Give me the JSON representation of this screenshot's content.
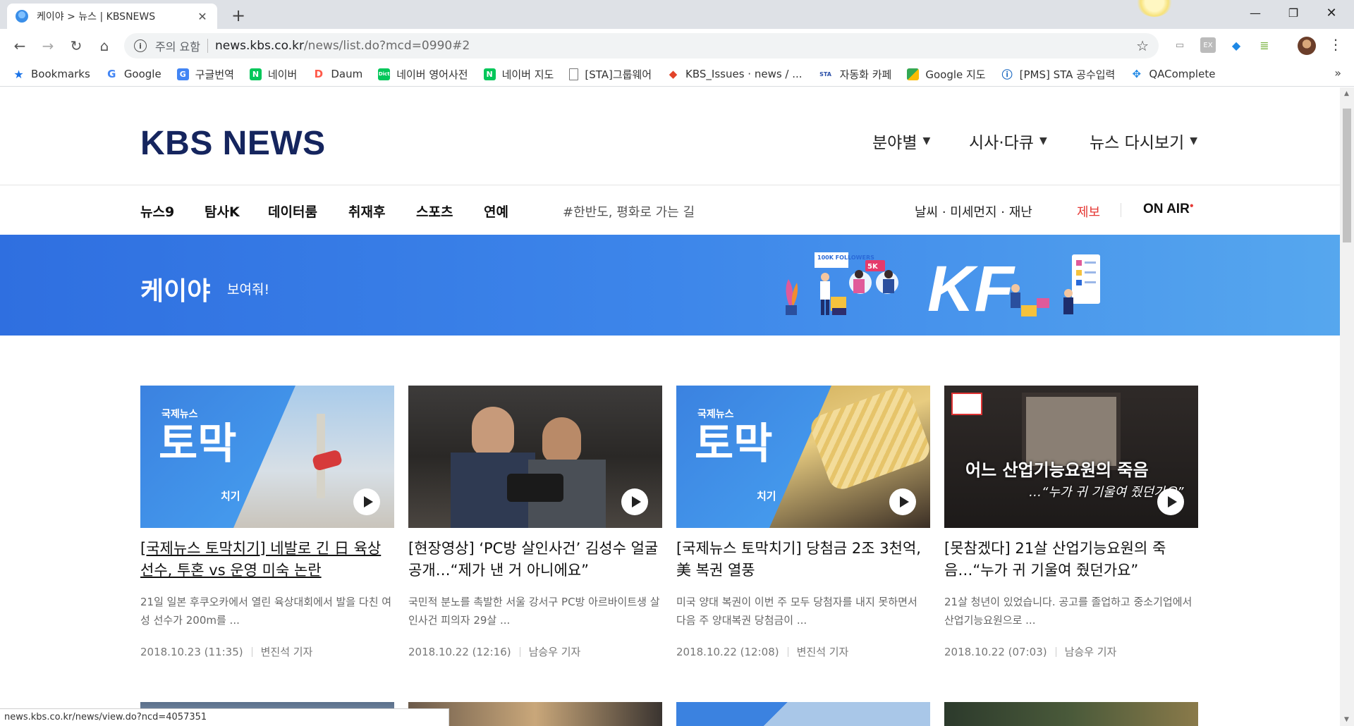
{
  "browser": {
    "tab_title": "케이야 > 뉴스 | KBSNEWS",
    "url_warning": "주의 요함",
    "url_host": "news.kbs.co.kr",
    "url_path": "/news/list.do?mcd=0990#2",
    "status_url": "news.kbs.co.kr/news/view.do?ncd=4057351"
  },
  "bookmarks": [
    {
      "label": "Bookmarks",
      "icon": "star-icon",
      "color": "#1a73e8"
    },
    {
      "label": "Google",
      "icon": "google-icon",
      "color": "#4285f4"
    },
    {
      "label": "구글번역",
      "icon": "translate-icon",
      "color": "#4285f4"
    },
    {
      "label": "네이버",
      "icon": "naver-icon",
      "color": "#03c75a"
    },
    {
      "label": "Daum",
      "icon": "daum-icon",
      "color": "#ff5a4a"
    },
    {
      "label": "네이버 영어사전",
      "icon": "dict-icon",
      "color": "#03c75a"
    },
    {
      "label": "네이버 지도",
      "icon": "naver-icon",
      "color": "#03c75a"
    },
    {
      "label": "[STA]그룹웨어",
      "icon": "page-icon",
      "color": "#777777"
    },
    {
      "label": "KBS_Issues · news / ...",
      "icon": "gitlab-icon",
      "color": "#e24329"
    },
    {
      "label": "자동화 카페",
      "icon": "sta-icon",
      "color": "#2a4fa8"
    },
    {
      "label": "Google 지도",
      "icon": "maps-icon",
      "color": "#34a853"
    },
    {
      "label": "[PMS] STA 공수입력",
      "icon": "pms-icon",
      "color": "#1565c0"
    },
    {
      "label": "QAComplete",
      "icon": "qa-icon",
      "color": "#1e88e5"
    }
  ],
  "header": {
    "logo": "KBS NEWS",
    "menus": [
      "분야별",
      "시사·다큐",
      "뉴스 다시보기"
    ]
  },
  "subnav": {
    "items": [
      "뉴스9",
      "탐사K",
      "데이터룸",
      "취재후",
      "스포츠",
      "연예"
    ],
    "hashtag": "#한반도, 평화로 가는 길",
    "weather": "날씨 · 미세먼지 · 재난",
    "report": "제보",
    "onair": "ON AIR"
  },
  "banner": {
    "title": "케이야",
    "subtitle": "보여줘!",
    "badge_followers": "100K FOLLOWERS",
    "badge_count": "5K"
  },
  "articles": [
    {
      "thumb_overlay": [
        "국제뉴스",
        "토막",
        "치기"
      ],
      "title": "[국제뉴스 토막치기] 네발로 긴 日 육상선수, 투혼 vs 운영 미숙 논란",
      "desc": "21일 일본 후쿠오카에서 열린 육상대회에서 발을 다친 여성 선수가 200m를 ...",
      "date": "2018.10.23 (11:35)",
      "reporter": "변진석 기자"
    },
    {
      "thumb_overlay": [],
      "title": "[현장영상] ‘PC방 살인사건’ 김성수 얼굴 공개…“제가 낸 거 아니에요”",
      "desc": "국민적 분노를 촉발한 서울 강서구 PC방 아르바이트생 살인사건 피의자 29살 ...",
      "date": "2018.10.22 (12:16)",
      "reporter": "남승우 기자"
    },
    {
      "thumb_overlay": [
        "국제뉴스",
        "토막",
        "치기"
      ],
      "title": "[국제뉴스 토막치기] 당첨금 2조 3천억, 美 복권 열풍",
      "desc": "미국 양대 복권이 이번 주 모두 당첨자를 내지 못하면서 다음 주 양대복권 당첨금이 ...",
      "date": "2018.10.22 (12:08)",
      "reporter": "변진석 기자"
    },
    {
      "thumb_overlay": [
        "어느 산업기능요원의 죽음",
        "…“누가 귀 기울여 줬던가요”"
      ],
      "title": "[못참겠다] 21살 산업기능요원의 죽음…“누가 귀 기울여 줬던가요”",
      "desc": "21살 청년이 있었습니다. 공고를 졸업하고 중소기업에서 산업기능요원으로 ...",
      "date": "2018.10.22 (07:03)",
      "reporter": "남승우 기자"
    }
  ]
}
